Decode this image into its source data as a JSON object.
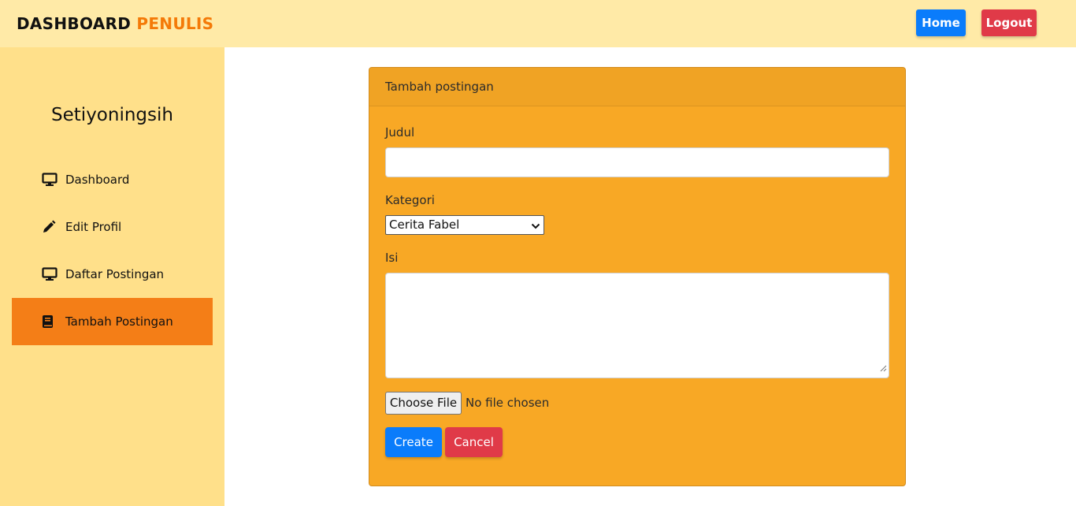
{
  "header": {
    "brand_primary": "DASHBOARD",
    "brand_accent": "PENULIS",
    "home_label": "Home",
    "logout_label": "Logout"
  },
  "sidebar": {
    "user_name": "Setiyoningsih",
    "items": [
      {
        "label": "Dashboard",
        "icon": "monitor-icon",
        "active": false
      },
      {
        "label": "Edit Profil",
        "icon": "pencil-icon",
        "active": false
      },
      {
        "label": "Daftar Postingan",
        "icon": "monitor-icon",
        "active": false
      },
      {
        "label": "Tambah Postingan",
        "icon": "book-icon",
        "active": true
      }
    ]
  },
  "form": {
    "title": "Tambah postingan",
    "judul_label": "Judul",
    "judul_value": "",
    "kategori_label": "Kategori",
    "kategori_selected": "Cerita Fabel",
    "isi_label": "Isi",
    "isi_value": "",
    "file_button_label": "Choose File",
    "file_status": "No file chosen",
    "create_label": "Create",
    "cancel_label": "Cancel"
  },
  "colors": {
    "topbar_bg": "#ffeaa7",
    "sidebar_bg": "#ffe08a",
    "active_item_bg": "#f47e17",
    "card_bg": "#f8a825",
    "primary": "#0a7cfb",
    "danger": "#e03a48",
    "brand_accent": "#f47a08"
  }
}
